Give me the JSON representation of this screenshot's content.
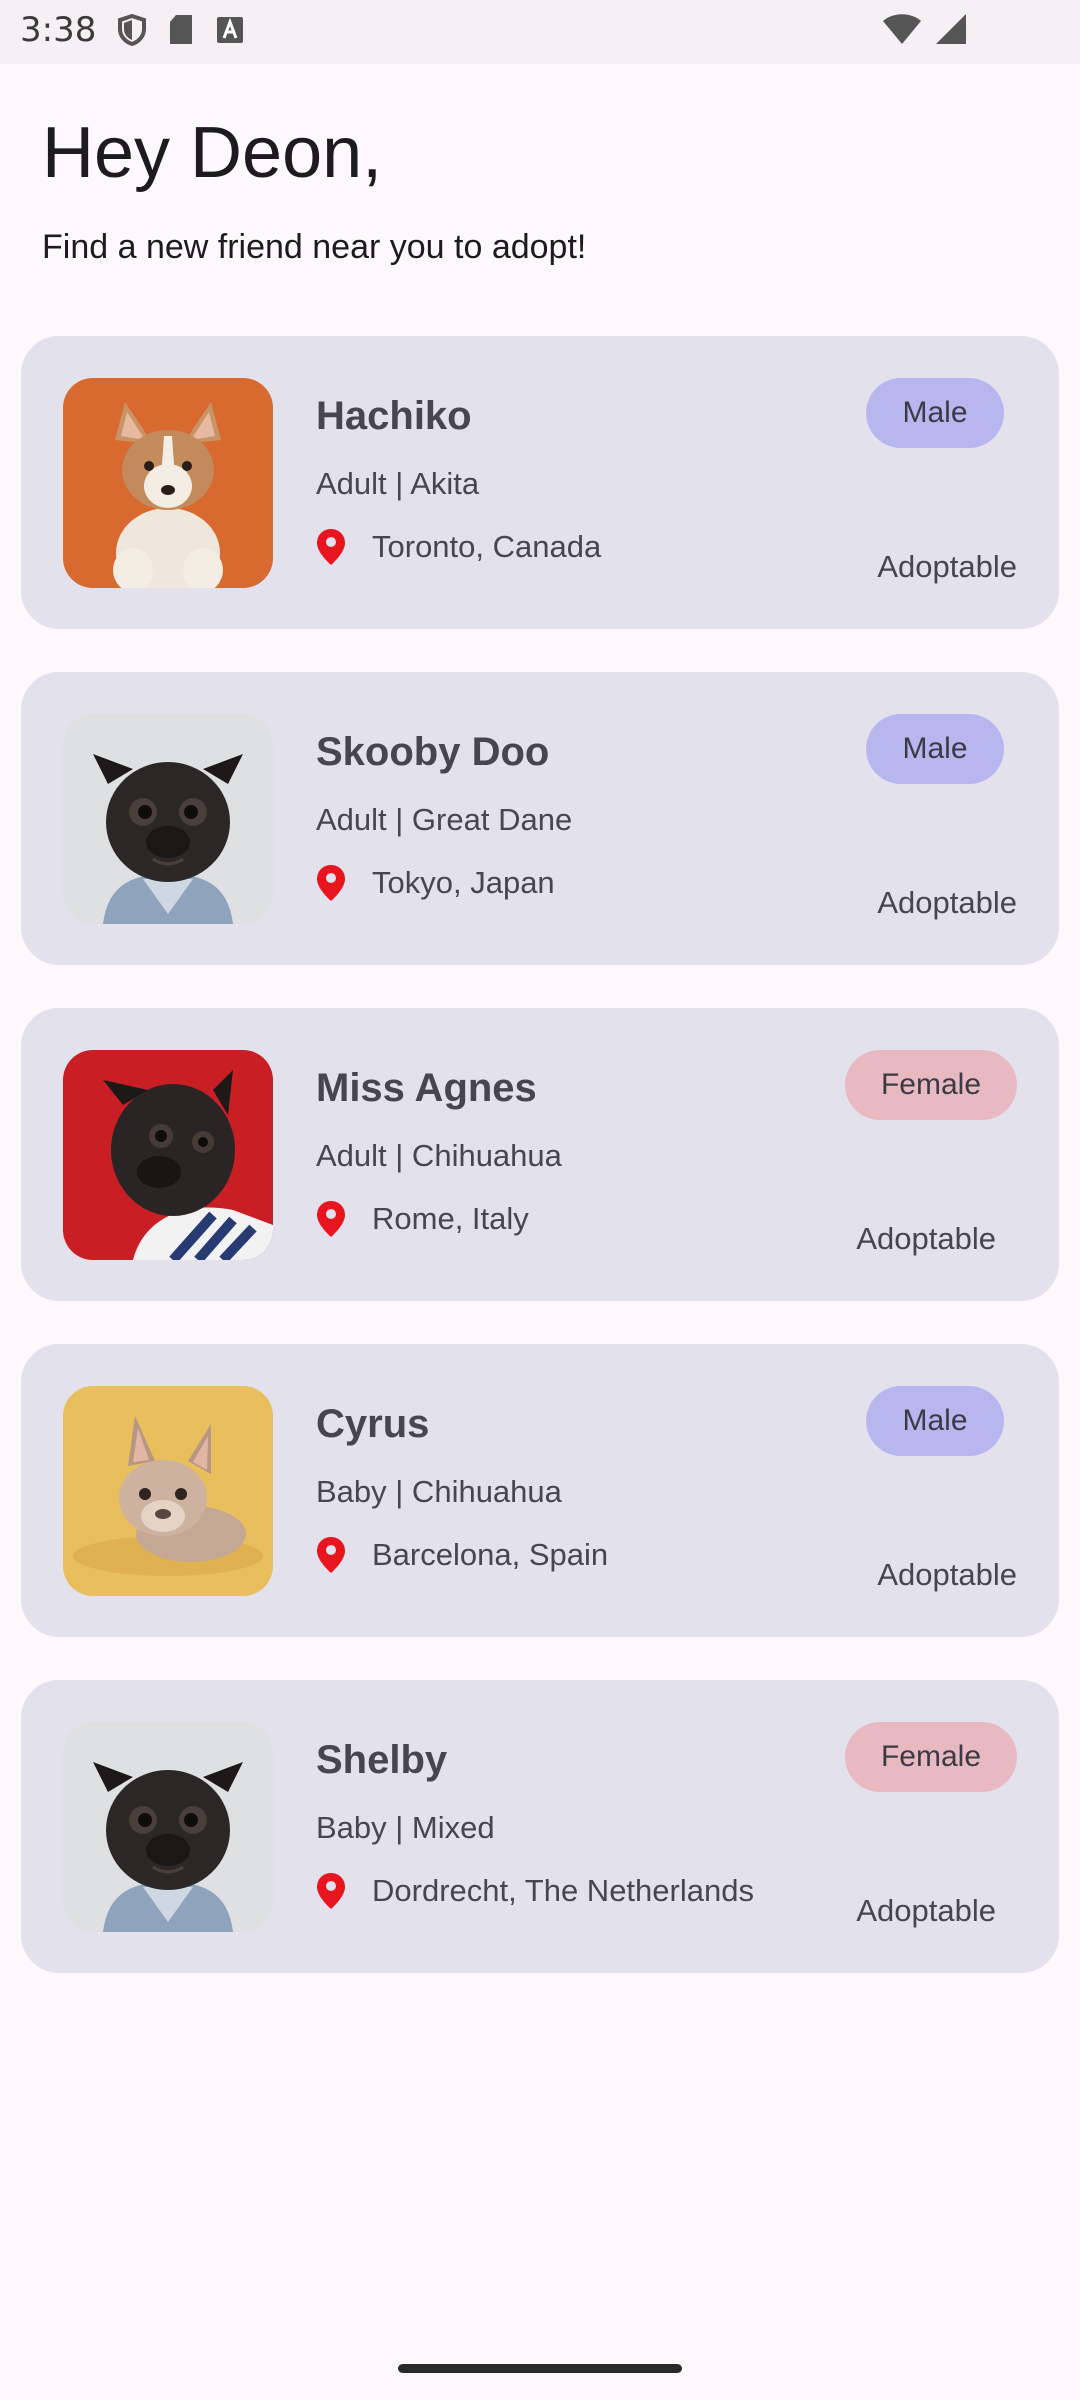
{
  "status_bar": {
    "time": "3:38",
    "icons_left": [
      "shield-icon",
      "sd-card-icon",
      "font-icon"
    ],
    "icons_right": [
      "wifi-icon",
      "cell-signal-icon"
    ]
  },
  "header": {
    "greeting": "Hey Deon,",
    "subtitle": "Find a new friend near you to adopt!"
  },
  "colors": {
    "male_badge": "#b8b6ef",
    "female_badge": "#e8b9c1",
    "location_pin": "#e8141e",
    "card_background": "#e3e2ec"
  },
  "pets": [
    {
      "name": "Hachiko",
      "description": "Adult | Akita",
      "location": "Toronto, Canada",
      "gender": "Male",
      "status": "Adoptable",
      "photo": "corgi-puppy-orange-background"
    },
    {
      "name": "Skooby Doo",
      "description": "Adult | Great Dane",
      "location": "Tokyo, Japan",
      "gender": "Male",
      "status": "Adoptable",
      "photo": "pug-grey-background"
    },
    {
      "name": "Miss Agnes",
      "description": "Adult | Chihuahua",
      "location": "Rome, Italy",
      "gender": "Female",
      "status": "Adoptable",
      "photo": "pug-red-background"
    },
    {
      "name": "Cyrus",
      "description": "Baby | Chihuahua",
      "location": "Barcelona, Spain",
      "gender": "Male",
      "status": "Adoptable",
      "photo": "bulldog-yellow-background"
    },
    {
      "name": "Shelby",
      "description": "Baby | Mixed",
      "location": "Dordrecht, The Netherlands",
      "gender": "Female",
      "status": "Adoptable",
      "photo": "pug-grey-background"
    }
  ]
}
